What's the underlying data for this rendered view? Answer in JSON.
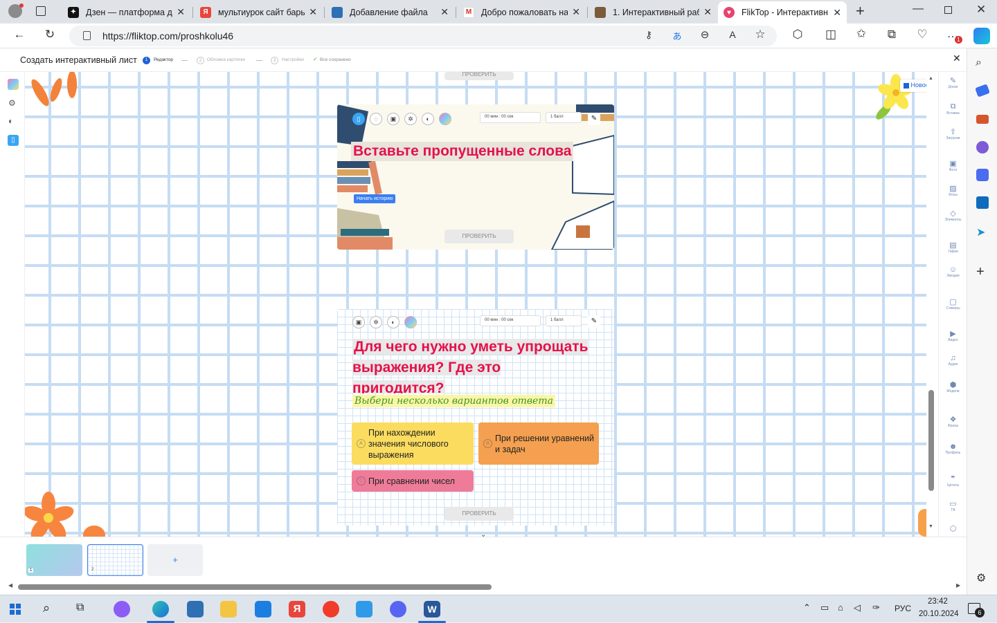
{
  "browser": {
    "tabs": [
      {
        "title": "Дзен — платформа дл",
        "icon": "dzen-icon",
        "color": "#111111"
      },
      {
        "title": "мультиурок сайт бары",
        "icon": "yandex-icon",
        "color": "#e8463c"
      },
      {
        "title": "Добавление файла",
        "icon": "book-icon",
        "color": "#2f6fb3"
      },
      {
        "title": "Добро пожаловать на",
        "icon": "gmail-icon",
        "color": "#d93025"
      },
      {
        "title": "1. Интерактивный раб",
        "icon": "worksheet-icon",
        "color": "#7a5c3a"
      },
      {
        "title": "FlikTop - Интерактивн",
        "icon": "fliktop-icon",
        "color": "#e5446d"
      }
    ],
    "url": "https://fliktop.com/proshkolu46",
    "edge_badge": "1"
  },
  "header": {
    "title": "Создать интерактивный лист",
    "steps": [
      {
        "num": "1",
        "label": "Редактор"
      },
      {
        "num": "2",
        "label": "Обложка карточки"
      },
      {
        "num": "3",
        "label": "Настройки"
      }
    ],
    "saved": "Все сохранено"
  },
  "new_badge": "Новое",
  "right_tools": [
    "Доски",
    "Вставка",
    "Загрузки",
    "Фото",
    "Фоны",
    "Элементы",
    "Гифки",
    "Звездки",
    "Стикеры",
    "Видео",
    "Аудио",
    "Модели",
    "Фразы",
    "Профиль",
    "Цитаты",
    "ТВ"
  ],
  "card1": {
    "title": "Вставьте пропущенные слова",
    "start_button": "Начать историю",
    "timer": "00 мин : 00 сек",
    "points": "1 балл",
    "check": "ПРОВЕРИТЬ",
    "check_prev": "ПРОВЕРИТЬ"
  },
  "card2": {
    "title": "Для чего нужно уметь упрощать выражения? Где это пригодится?",
    "subtitle": "Выбери несколько вариантов ответа",
    "timer": "00 мин : 00 сек",
    "points": "1 балл",
    "options": [
      {
        "letter": "A",
        "text": "При нахождении значения числового выражения",
        "color": "#fbdc5f"
      },
      {
        "letter": "B",
        "text": "При решении уравнений и задач",
        "color": "#f4a050"
      },
      {
        "letter": "C",
        "text": "При сравнении чисел",
        "color": "#ee7c99"
      }
    ],
    "check": "ПРОВЕРИТЬ"
  },
  "thumbnails": [
    {
      "num": "1"
    },
    {
      "num": "2"
    }
  ],
  "add_page": "+",
  "taskbar": {
    "lang": "РУС",
    "time": "23:42",
    "date": "20.10.2024",
    "notifications": "6"
  }
}
